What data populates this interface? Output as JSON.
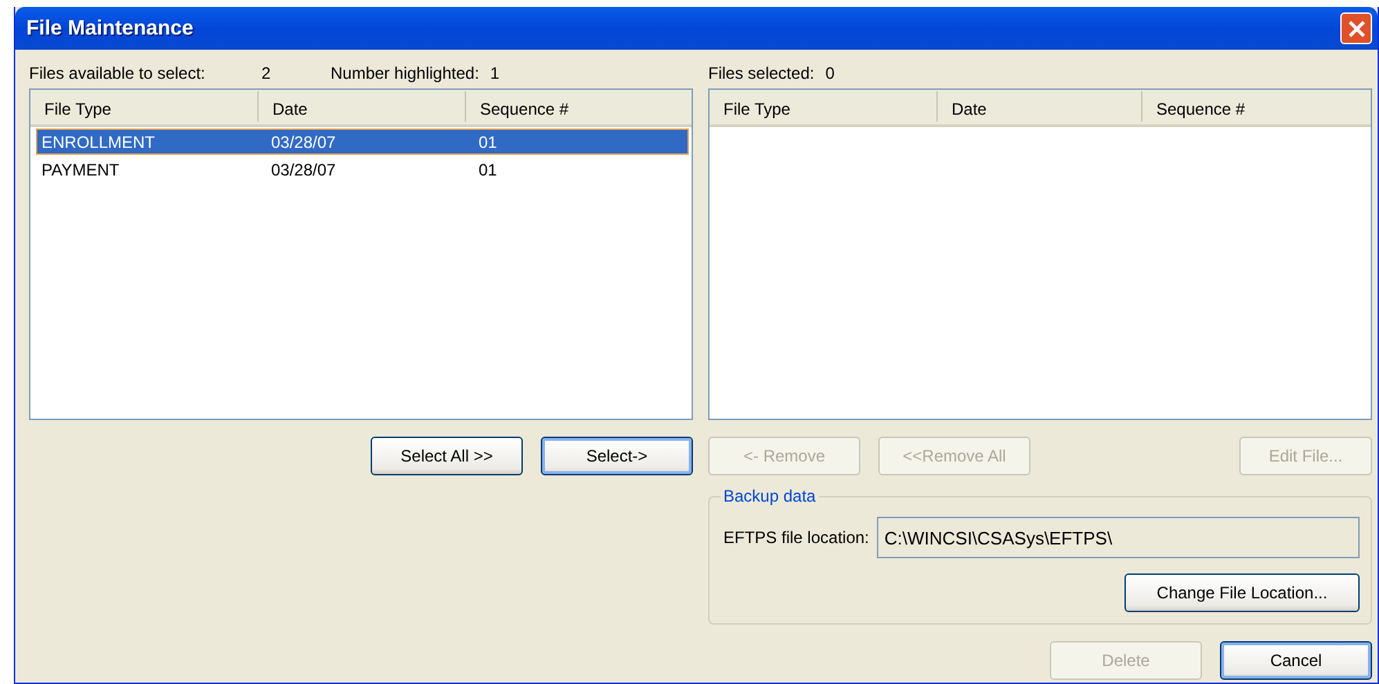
{
  "window": {
    "title": "File Maintenance"
  },
  "available": {
    "label": "Files available to select:",
    "count": "2",
    "highlighted_label": "Number highlighted:",
    "highlighted": "1"
  },
  "left_table": {
    "columns": [
      "File Type",
      "Date",
      "Sequence #"
    ],
    "rows": [
      {
        "cells": [
          "ENROLLMENT",
          "03/28/07",
          "01"
        ],
        "selected": true
      },
      {
        "cells": [
          "PAYMENT",
          "03/28/07",
          "01"
        ],
        "selected": false
      }
    ]
  },
  "selected_files": {
    "label": "Files selected:",
    "count": "0"
  },
  "right_table": {
    "columns": [
      "File Type",
      "Date",
      "Sequence #"
    ]
  },
  "left_buttons": [
    {
      "label": "Select All >>",
      "disabled": false,
      "default": false
    },
    {
      "label": "Select->",
      "disabled": false,
      "default": true
    }
  ],
  "right_buttons": [
    {
      "label": "<- Remove",
      "disabled": true,
      "default": false
    },
    {
      "label": "<<Remove All",
      "disabled": true,
      "default": false
    },
    {
      "label": "Edit File...",
      "disabled": true,
      "default": false
    }
  ],
  "backup": {
    "title": "Backup data",
    "location_label": "EFTPS file location:",
    "location": "C:\\WINCSI\\CSASys\\EFTPS\\",
    "change_button": {
      "label": "Change File Location...",
      "disabled": false,
      "default": false
    }
  },
  "bottom_buttons": [
    {
      "label": "Delete",
      "disabled": true,
      "default": false
    },
    {
      "label": "Cancel",
      "disabled": false,
      "default": true
    }
  ]
}
